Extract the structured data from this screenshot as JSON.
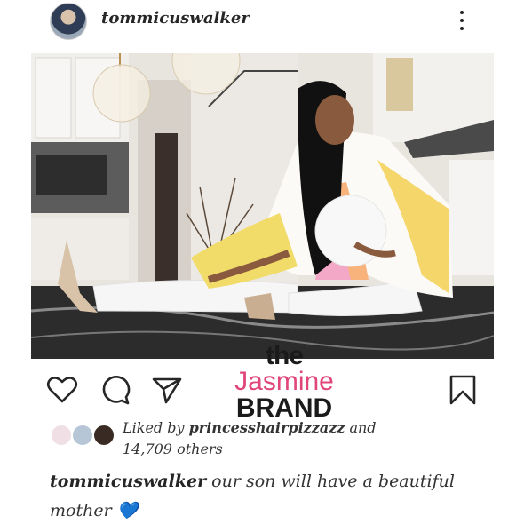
{
  "post": {
    "username": "tommicuswalker",
    "avatar_icon": "profile-avatar"
  },
  "watermark": {
    "line1": "the",
    "line2": "Jasmine",
    "line3": "BRAND",
    "accent": "#e0457b"
  },
  "actions": {
    "like_icon": "heart-icon",
    "comment_icon": "comment-icon",
    "share_icon": "send-icon",
    "save_icon": "bookmark-icon"
  },
  "likes": {
    "prefix": "Liked by",
    "user": "princesshairpizzazz",
    "connector": "and",
    "count": "14,709 others"
  },
  "caption": {
    "username": "tommicuswalker",
    "text": "our son will have a beautiful mother",
    "emoji": "💙"
  }
}
